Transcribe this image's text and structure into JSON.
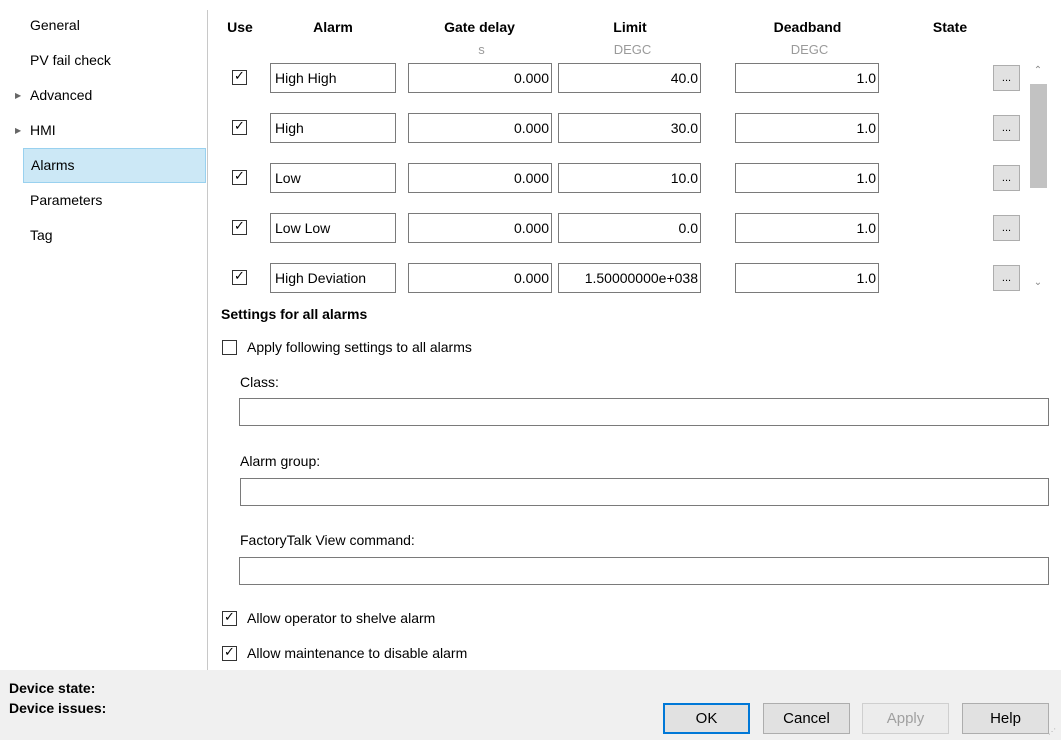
{
  "nav": {
    "items": [
      {
        "label": "General",
        "expandable": false,
        "selected": false
      },
      {
        "label": "PV fail check",
        "expandable": false,
        "selected": false
      },
      {
        "label": "Advanced",
        "expandable": true,
        "selected": false
      },
      {
        "label": "HMI",
        "expandable": true,
        "selected": false
      },
      {
        "label": "Alarms",
        "expandable": false,
        "selected": true
      },
      {
        "label": "Parameters",
        "expandable": false,
        "selected": false
      },
      {
        "label": "Tag",
        "expandable": false,
        "selected": false
      }
    ]
  },
  "table": {
    "headers": {
      "use": "Use",
      "alarm": "Alarm",
      "gate_delay": "Gate delay",
      "limit": "Limit",
      "deadband": "Deadband",
      "state": "State"
    },
    "units": {
      "gate_delay": "s",
      "limit": "DEGC",
      "deadband": "DEGC"
    },
    "rows": [
      {
        "use": true,
        "alarm": "High High",
        "gate_delay": "0.000",
        "limit": "40.0",
        "deadband": "1.0",
        "state_button": "..."
      },
      {
        "use": true,
        "alarm": "High",
        "gate_delay": "0.000",
        "limit": "30.0",
        "deadband": "1.0",
        "state_button": "..."
      },
      {
        "use": true,
        "alarm": "Low",
        "gate_delay": "0.000",
        "limit": "10.0",
        "deadband": "1.0",
        "state_button": "..."
      },
      {
        "use": true,
        "alarm": "Low Low",
        "gate_delay": "0.000",
        "limit": "0.0",
        "deadband": "1.0",
        "state_button": "..."
      },
      {
        "use": true,
        "alarm": "High Deviation",
        "gate_delay": "0.000",
        "limit": "1.50000000e+038",
        "deadband": "1.0",
        "state_button": "..."
      }
    ],
    "check_glyph": "✓",
    "scroll_up_glyph": "⌃",
    "scroll_down_glyph": "⌄"
  },
  "settings": {
    "title": "Settings for all alarms",
    "apply_all": {
      "label": "Apply following settings to all alarms",
      "checked": false
    },
    "class_label": "Class:",
    "class_value": "",
    "alarm_group_label": "Alarm group:",
    "alarm_group_value": "",
    "ftview_label": "FactoryTalk View command:",
    "ftview_value": "",
    "allow_shelve": {
      "label": "Allow operator to shelve alarm",
      "checked": true
    },
    "allow_disable": {
      "label": "Allow maintenance to disable alarm",
      "checked": true
    }
  },
  "footer": {
    "device_state_label": "Device state:",
    "device_issues_label": "Device issues:",
    "ok": "OK",
    "cancel": "Cancel",
    "apply": "Apply",
    "help": "Help"
  },
  "colors": {
    "nav_selected_bg": "#cce8f6",
    "nav_selected_border": "#99d1ef",
    "default_button_border": "#0078d7",
    "footer_bg": "#f0f0f0"
  },
  "icons": {
    "expand_arrow": "▶",
    "resize_grip": "⋰"
  }
}
